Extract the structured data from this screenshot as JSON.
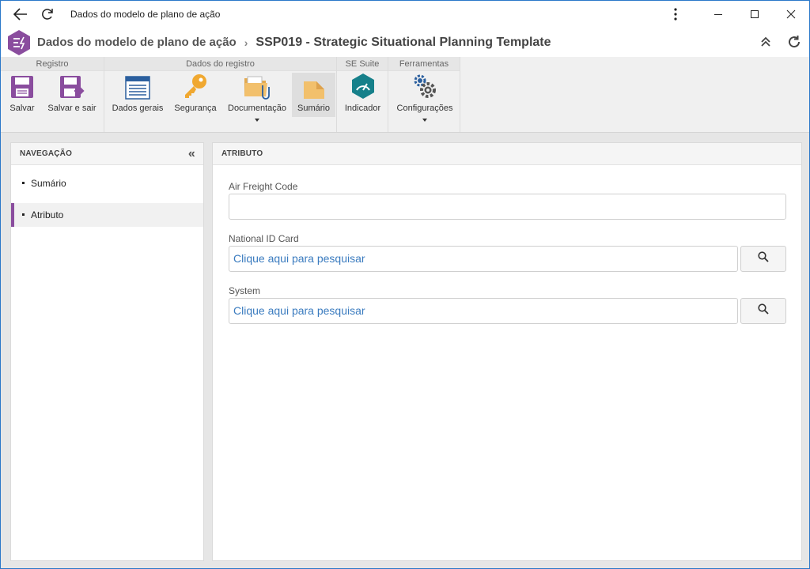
{
  "window": {
    "title": "Dados do modelo de plano de ação",
    "back_icon": "arrow-left-icon",
    "refresh_icon": "refresh-icon",
    "menu_icon": "more-vertical-icon",
    "minimize_icon": "minimize-icon",
    "maximize_icon": "maximize-icon",
    "close_icon": "close-icon"
  },
  "header": {
    "breadcrumb": "Dados do modelo de plano de ação",
    "separator": "›",
    "title": "SSP019 - Strategic Situational Planning Template",
    "logo_color": "#8a4d9e"
  },
  "ribbon": {
    "groups": [
      {
        "title": "Registro",
        "buttons": [
          {
            "label": "Salvar",
            "icon": "save-icon"
          },
          {
            "label": "Salvar e sair",
            "icon": "save-exit-icon"
          }
        ]
      },
      {
        "title": "Dados do registro",
        "buttons": [
          {
            "label": "Dados gerais",
            "icon": "general-data-icon"
          },
          {
            "label": "Segurança",
            "icon": "key-icon"
          },
          {
            "label": "Documentação",
            "icon": "documentation-icon"
          },
          {
            "label": "Sumário",
            "icon": "summary-folder-icon"
          }
        ]
      },
      {
        "title": "SE Suite",
        "buttons": [
          {
            "label": "Indicador",
            "icon": "indicator-gauge-icon"
          }
        ]
      },
      {
        "title": "Ferramentas",
        "buttons": [
          {
            "label": "Configurações",
            "icon": "gears-icon"
          }
        ]
      }
    ]
  },
  "navigation": {
    "title": "NAVEGAÇÃO",
    "collapse_label": "«",
    "items": [
      {
        "label": "Sumário",
        "active": false
      },
      {
        "label": "Atributo",
        "active": true
      }
    ],
    "accent_color": "#8a4d9e"
  },
  "content": {
    "title": "ATRIBUTO",
    "fields": [
      {
        "label": "Air Freight Code",
        "value": "",
        "type": "text"
      },
      {
        "label": "National ID Card",
        "placeholder": "Clique aqui para pesquisar",
        "type": "lookup"
      },
      {
        "label": "System",
        "placeholder": "Clique aqui para pesquisar",
        "type": "lookup"
      }
    ]
  }
}
